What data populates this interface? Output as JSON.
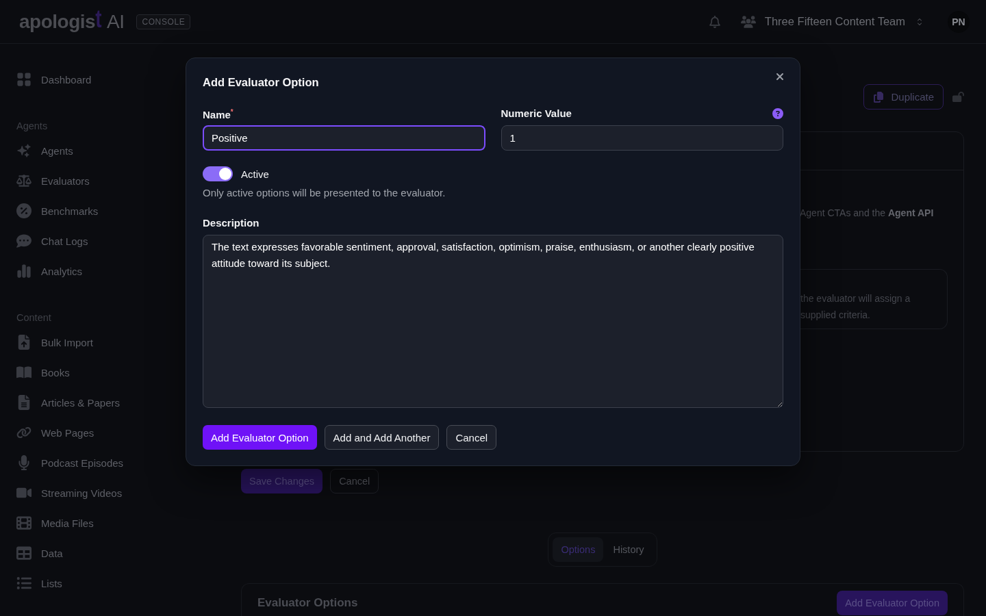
{
  "header": {
    "logo": {
      "wordmark": "apologist",
      "suffix": "AI"
    },
    "badge": "CONSOLE",
    "team": "Three Fifteen Content Team",
    "avatar": "PN"
  },
  "sidebar": {
    "sections": [
      {
        "items": [
          {
            "label": "Dashboard"
          }
        ]
      },
      {
        "title": "Agents",
        "items": [
          {
            "label": "Agents"
          },
          {
            "label": "Evaluators"
          },
          {
            "label": "Benchmarks"
          },
          {
            "label": "Chat Logs"
          },
          {
            "label": "Analytics"
          }
        ]
      },
      {
        "title": "Content",
        "items": [
          {
            "label": "Bulk Import"
          },
          {
            "label": "Books"
          },
          {
            "label": "Articles & Papers"
          },
          {
            "label": "Web Pages"
          },
          {
            "label": "Podcast Episodes"
          },
          {
            "label": "Streaming Videos"
          },
          {
            "label": "Media Files"
          },
          {
            "label": "Data"
          },
          {
            "label": "Lists"
          }
        ]
      }
    ]
  },
  "page": {
    "duplicate_button": "Duplicate",
    "agent_note": "Agent CTAs and the **Agent API**",
    "grader_card": {
      "lines": [
        "the evaluator will assign a",
        "supplied criteria."
      ]
    },
    "actions": [
      {
        "label": "Save Changes",
        "kind": "primary"
      },
      {
        "label": "Cancel",
        "kind": "secondary"
      }
    ],
    "tabs": [
      {
        "label": "Options",
        "selected": true
      },
      {
        "label": "History",
        "selected": false
      }
    ],
    "options_card": {
      "title": "Evaluator Options",
      "button": "Add Evaluator Option"
    }
  },
  "modal": {
    "title": "Add Evaluator Option",
    "fields": [
      {
        "label": "Name$^{*}$",
        "value": "Positive",
        "focused": true,
        "help": false
      },
      {
        "label": "Numeric Value",
        "value": "1",
        "focused": false,
        "help": true
      }
    ],
    "toggle": {
      "label": "Active",
      "on": true,
      "hint": "Only active options will be presented to the evaluator."
    },
    "description": {
      "label": "Description",
      "value": "The text expresses favorable sentiment, approval, satisfaction, optimism, praise, enthusiasm, or another clearly positive attitude toward its subject."
    },
    "buttons": [
      {
        "label": "Add Evaluator Option",
        "kind": "primary"
      },
      {
        "label": "Add and Add Another",
        "kind": "secondary"
      },
      {
        "label": "Cancel",
        "kind": "secondary"
      }
    ]
  }
}
